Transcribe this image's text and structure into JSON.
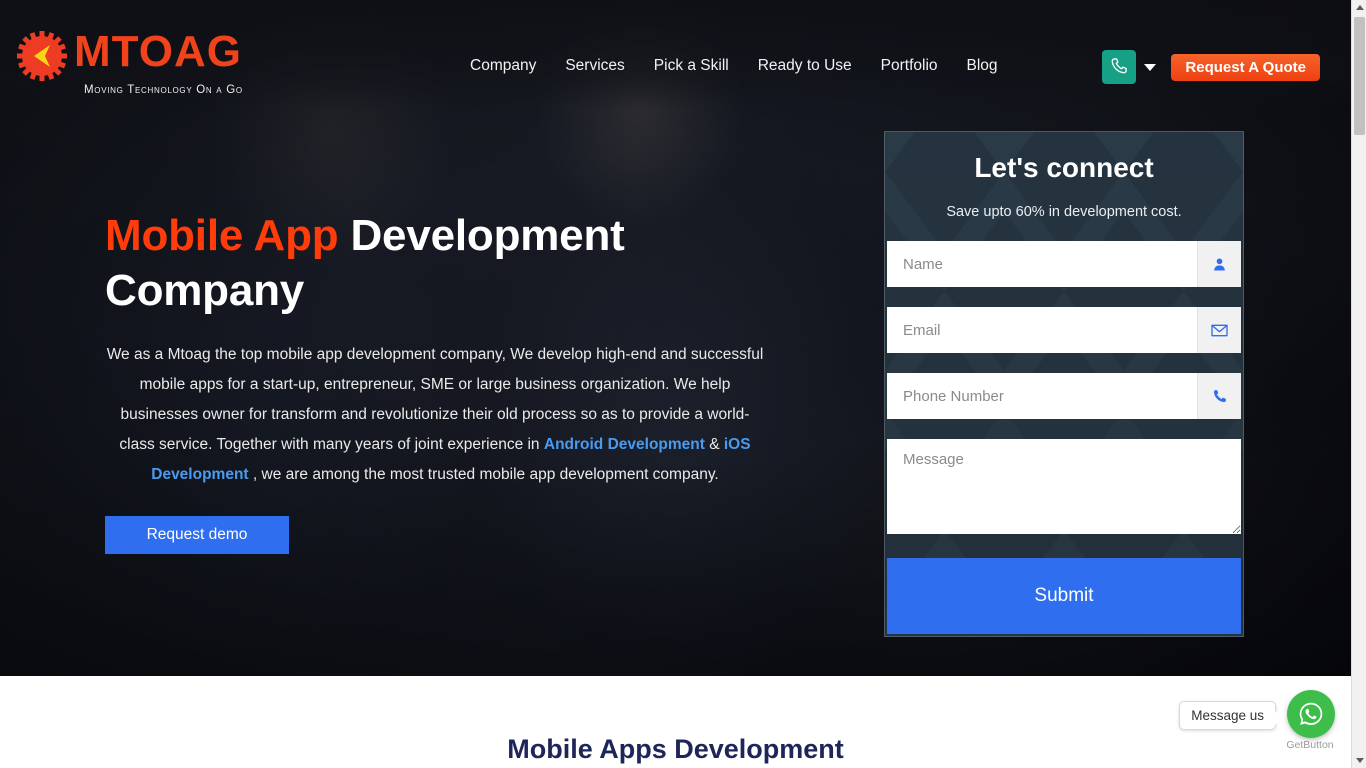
{
  "header": {
    "logo": {
      "wordmark": "MTOAG",
      "tagline": "Moving Technology On a Go",
      "mark_icon": "mtoag-sun-arrow-logo-icon"
    },
    "nav": [
      {
        "label": "Company"
      },
      {
        "label": "Services"
      },
      {
        "label": "Pick a Skill"
      },
      {
        "label": "Ready to Use"
      },
      {
        "label": "Portfolio"
      },
      {
        "label": "Blog"
      }
    ],
    "phone_button": {
      "icon": "phone-icon"
    },
    "dropdown": {
      "icon": "chevron-down-icon"
    },
    "quote_button": {
      "label": "Request A Quote"
    }
  },
  "hero": {
    "title_accent": "Mobile App",
    "title_rest": " Development Company",
    "paragraph_part1": "We as a Mtoag the top mobile app development company, We develop high-end and successful mobile apps for a start-up, entrepreneur, SME or large business organization. We help businesses owner for transform and revolutionize their old process so as to provide a world-class service. Together with many years of joint experience in ",
    "link_android": "Android Development",
    "paragraph_amp": " & ",
    "link_ios": "iOS Development",
    "paragraph_part2": " , we are among the most trusted mobile app development company.",
    "demo_button": "Request demo"
  },
  "contact_form": {
    "title": "Let's connect",
    "subtitle": "Save upto 60% in development cost.",
    "fields": [
      {
        "placeholder": "Name",
        "value": "",
        "icon": "user-icon"
      },
      {
        "placeholder": "Email",
        "value": "",
        "icon": "envelope-icon"
      },
      {
        "placeholder": "Phone Number",
        "value": "",
        "icon": "phone-icon"
      }
    ],
    "message": {
      "placeholder": "Message",
      "value": ""
    },
    "submit_label": "Submit"
  },
  "below_section": {
    "heading": "Mobile Apps Development"
  },
  "chat_widget": {
    "tooltip": "Message us",
    "brand": "GetButton",
    "icon": "whatsapp-icon"
  },
  "colors": {
    "accent_orange": "#ff3c0a",
    "quote_orange": "#ef3f11",
    "primary_blue": "#2f6fef",
    "link_blue": "#4a9bf0",
    "phone_green": "#16a085",
    "whatsapp_green": "#3ebd4b",
    "panel_dark": "#2b3a47",
    "heading_navy": "#1d2559"
  }
}
